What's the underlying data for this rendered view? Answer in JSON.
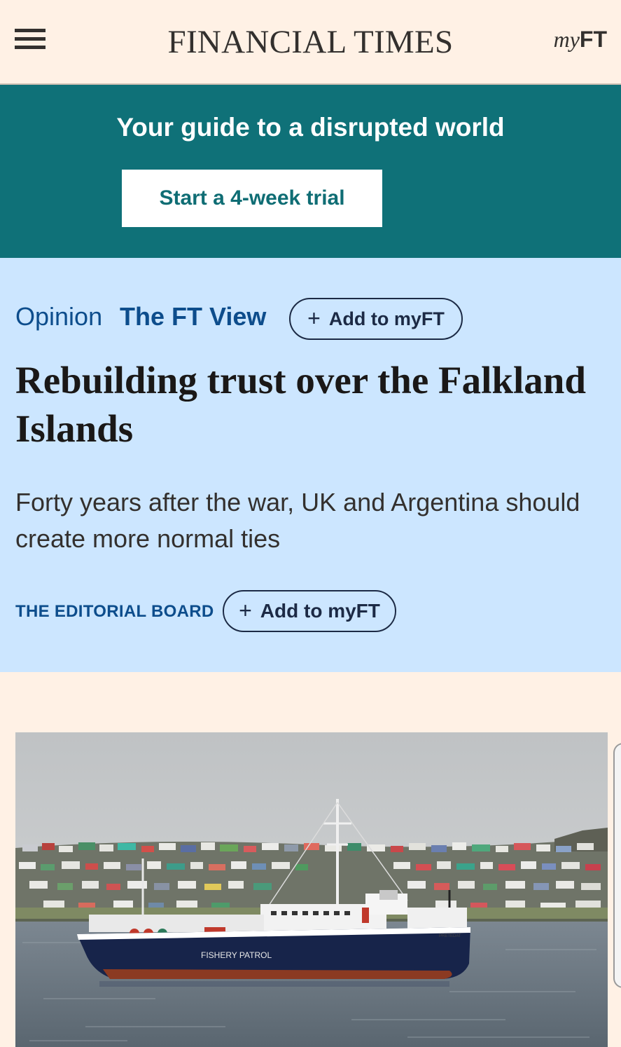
{
  "header": {
    "menu_icon": "hamburger-menu-icon",
    "masthead": "FINANCIAL TIMES",
    "myft_prefix": "my",
    "myft_suffix": "FT"
  },
  "promo": {
    "headline": "Your guide to a disrupted world",
    "cta_label": "Start a 4-week trial",
    "background_color": "#0f7178"
  },
  "article": {
    "section_label": "Opinion",
    "topic_label": "The FT View",
    "topic_follow_label": "Add to myFT",
    "title": "Rebuilding trust over the Falkland Islands",
    "standfirst": "Forty years after the war, UK and Argentina should create more normal ties",
    "author": "THE EDITORIAL BOARD",
    "author_follow_label": "Add to myFT",
    "follow_icon": "plus-icon",
    "background_color": "#cce6ff"
  },
  "image": {
    "ship_hull_text": "FISHERY PATROL",
    "ship_name_text": "PRETEDAT"
  },
  "theme": {
    "page_background": "#fff1e5",
    "accent_blue": "#0d4d8c"
  }
}
